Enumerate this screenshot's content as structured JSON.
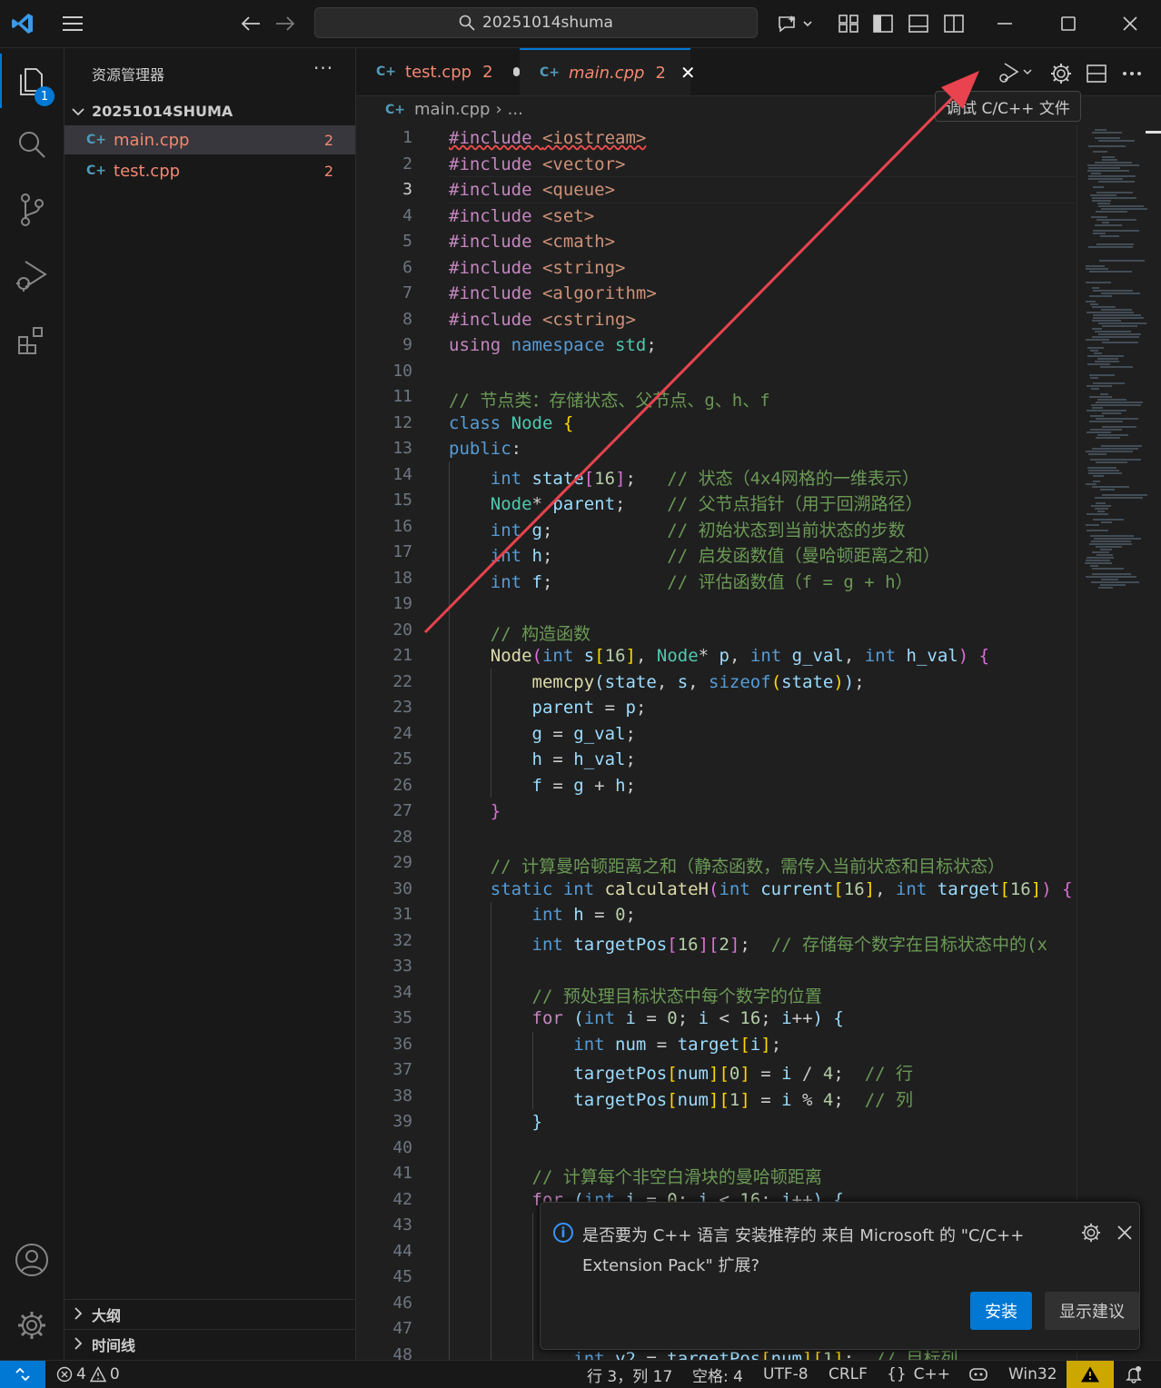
{
  "titlebar": {
    "search_text": "20251014shuma"
  },
  "activity": {
    "explorer_badge": "1"
  },
  "sidebar": {
    "title": "资源管理器",
    "more": "···",
    "folder": "20251014SHUMA",
    "files": [
      {
        "name": "main.cpp",
        "problems": "2"
      },
      {
        "name": "test.cpp",
        "problems": "2"
      }
    ],
    "sections": [
      {
        "label": "大纲"
      },
      {
        "label": "时间线"
      }
    ]
  },
  "tabs": [
    {
      "name": "test.cpp",
      "problems": "2",
      "modified": true
    },
    {
      "name": "main.cpp",
      "problems": "2",
      "active": true
    }
  ],
  "tooltip": "调试 C/C++ 文件",
  "breadcrumb": {
    "file": "main.cpp",
    "rest": "..."
  },
  "editor": {
    "current_line": 3,
    "lines": [
      "1",
      "2",
      "3",
      "4",
      "5",
      "6",
      "7",
      "8",
      "9",
      "10",
      "11",
      "12",
      "13",
      "14",
      "15",
      "16",
      "17",
      "18",
      "19",
      "20",
      "21",
      "22",
      "23",
      "24",
      "25",
      "26",
      "27",
      "28",
      "29",
      "30",
      "31",
      "32",
      "33",
      "34",
      "35",
      "36",
      "37",
      "38",
      "39",
      "40",
      "41",
      "42",
      "43",
      "44",
      "45",
      "46",
      "47",
      "48"
    ]
  },
  "notification": {
    "message_line1": "是否要为 C++ 语言 安装推荐的 来自 Microsoft 的 \"C/C++",
    "message_line2": "Extension Pack\" 扩展?",
    "install": "安装",
    "show": "显示建议"
  },
  "statusbar": {
    "errors": "4",
    "warnings": "0",
    "position": "行 3，列 17",
    "spaces": "空格: 4",
    "encoding": "UTF-8",
    "eol": "CRLF",
    "language": "C++",
    "language_mode": "{}",
    "platform": "Win32"
  },
  "colors": {
    "accent": "#0078d4",
    "annotation_arrow": "#e8434e",
    "error_text": "#f48771"
  }
}
